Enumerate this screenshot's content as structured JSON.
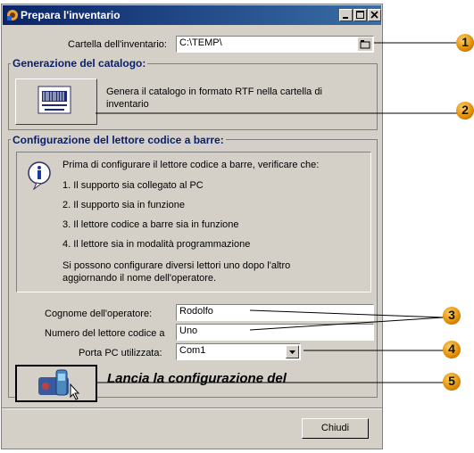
{
  "window": {
    "title": "Prepara l'inventario"
  },
  "folder": {
    "label": "Cartella dell'inventario:",
    "value": "C:\\TEMP\\"
  },
  "catalog_group": {
    "title": "Generazione del catalogo:",
    "description": "Genera il catalogo in formato RTF nella cartella di inventario"
  },
  "reader_group": {
    "title": "Configurazione del lettore codice a barre:",
    "intro": "Prima di configurare il lettore codice a barre, verificare che:",
    "items": [
      "1. Il supporto sia collegato al PC",
      "2. Il supporto sia in funzione",
      "3. Il lettore codice a barre sia in funzione",
      "4. Il lettore sia in modalità programmazione"
    ],
    "note_line1": "Si possono configurare diversi lettori uno dopo l'altro",
    "note_line2": "aggiornando il nome dell'operatore."
  },
  "operator": {
    "label": "Cognome dell'operatore:",
    "value": "Rodolfo"
  },
  "reader_number": {
    "label": "Numero del lettore codice a",
    "value": "Uno"
  },
  "port": {
    "label": "Porta PC utilizzata:",
    "value": "Com1"
  },
  "launch": {
    "label": "Lancia la configurazione del"
  },
  "close_button": {
    "label": "Chiudi"
  },
  "callouts": [
    "1",
    "2",
    "3",
    "4",
    "5"
  ],
  "colors": {
    "title_start": "#0a246a",
    "title_end": "#3a6ea5",
    "group_title": "#0a1e6e",
    "callout": "#e08a00"
  }
}
